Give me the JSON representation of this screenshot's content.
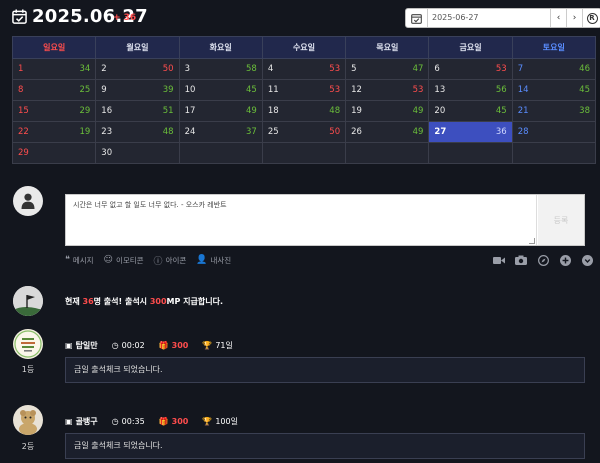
{
  "header": {
    "title": "2025.06.27",
    "count": "+ 36",
    "date_value": "2025-06-27",
    "prev": "‹",
    "next": "›",
    "today": "R"
  },
  "calendar": {
    "weekdays": [
      "일요일",
      "월요일",
      "화요일",
      "수요일",
      "목요일",
      "금요일",
      "토요일"
    ],
    "weeks": [
      [
        [
          "1",
          "34"
        ],
        [
          "2",
          "50"
        ],
        [
          "3",
          "58"
        ],
        [
          "4",
          "53"
        ],
        [
          "5",
          "47"
        ],
        [
          "6",
          "53"
        ],
        [
          "7",
          "46"
        ]
      ],
      [
        [
          "8",
          "25"
        ],
        [
          "9",
          "39"
        ],
        [
          "10",
          "45"
        ],
        [
          "11",
          "53"
        ],
        [
          "12",
          "53"
        ],
        [
          "13",
          "56"
        ],
        [
          "14",
          "45"
        ]
      ],
      [
        [
          "15",
          "29"
        ],
        [
          "16",
          "51"
        ],
        [
          "17",
          "49"
        ],
        [
          "18",
          "48"
        ],
        [
          "19",
          "49"
        ],
        [
          "20",
          "45"
        ],
        [
          "21",
          "38"
        ]
      ],
      [
        [
          "22",
          "19"
        ],
        [
          "23",
          "48"
        ],
        [
          "24",
          "37"
        ],
        [
          "25",
          "50"
        ],
        [
          "26",
          "49"
        ],
        [
          "27",
          "36"
        ],
        [
          "28",
          ""
        ]
      ],
      [
        [
          "29",
          ""
        ],
        [
          "30",
          ""
        ],
        [
          "",
          ""
        ],
        [
          "",
          ""
        ],
        [
          "",
          ""
        ],
        [
          "",
          ""
        ],
        [
          "",
          ""
        ]
      ]
    ],
    "red_counts": [
      "50",
      "53"
    ],
    "today": "27"
  },
  "composer": {
    "text": "시간은 너무 없고 할 일도 너무 없다. - 오스카 레반트",
    "send": "등록"
  },
  "tools": {
    "message": "메시지",
    "emoticon": "이모티콘",
    "icon": "아이콘",
    "photo": "내사진"
  },
  "info": {
    "pre": "현재 ",
    "count": "36",
    "mid": "명 출석! 출석시 ",
    "points": "300",
    "post": "MP 지급합니다."
  },
  "entries": [
    {
      "rank": "1등",
      "name": "탑일만",
      "time": "00:02",
      "points": "300",
      "days": "71일",
      "message": "금일 출석체크 되었습니다."
    },
    {
      "rank": "2등",
      "name": "골뱅구",
      "time": "00:35",
      "points": "300",
      "days": "100일",
      "message": "금일 출석체크 되었습니다."
    }
  ],
  "colors": {
    "accent_red": "#ff4d4d",
    "count_green": "#6bbf3a",
    "today_blue": "#3d4fbf",
    "sat_blue": "#5a8dff"
  }
}
